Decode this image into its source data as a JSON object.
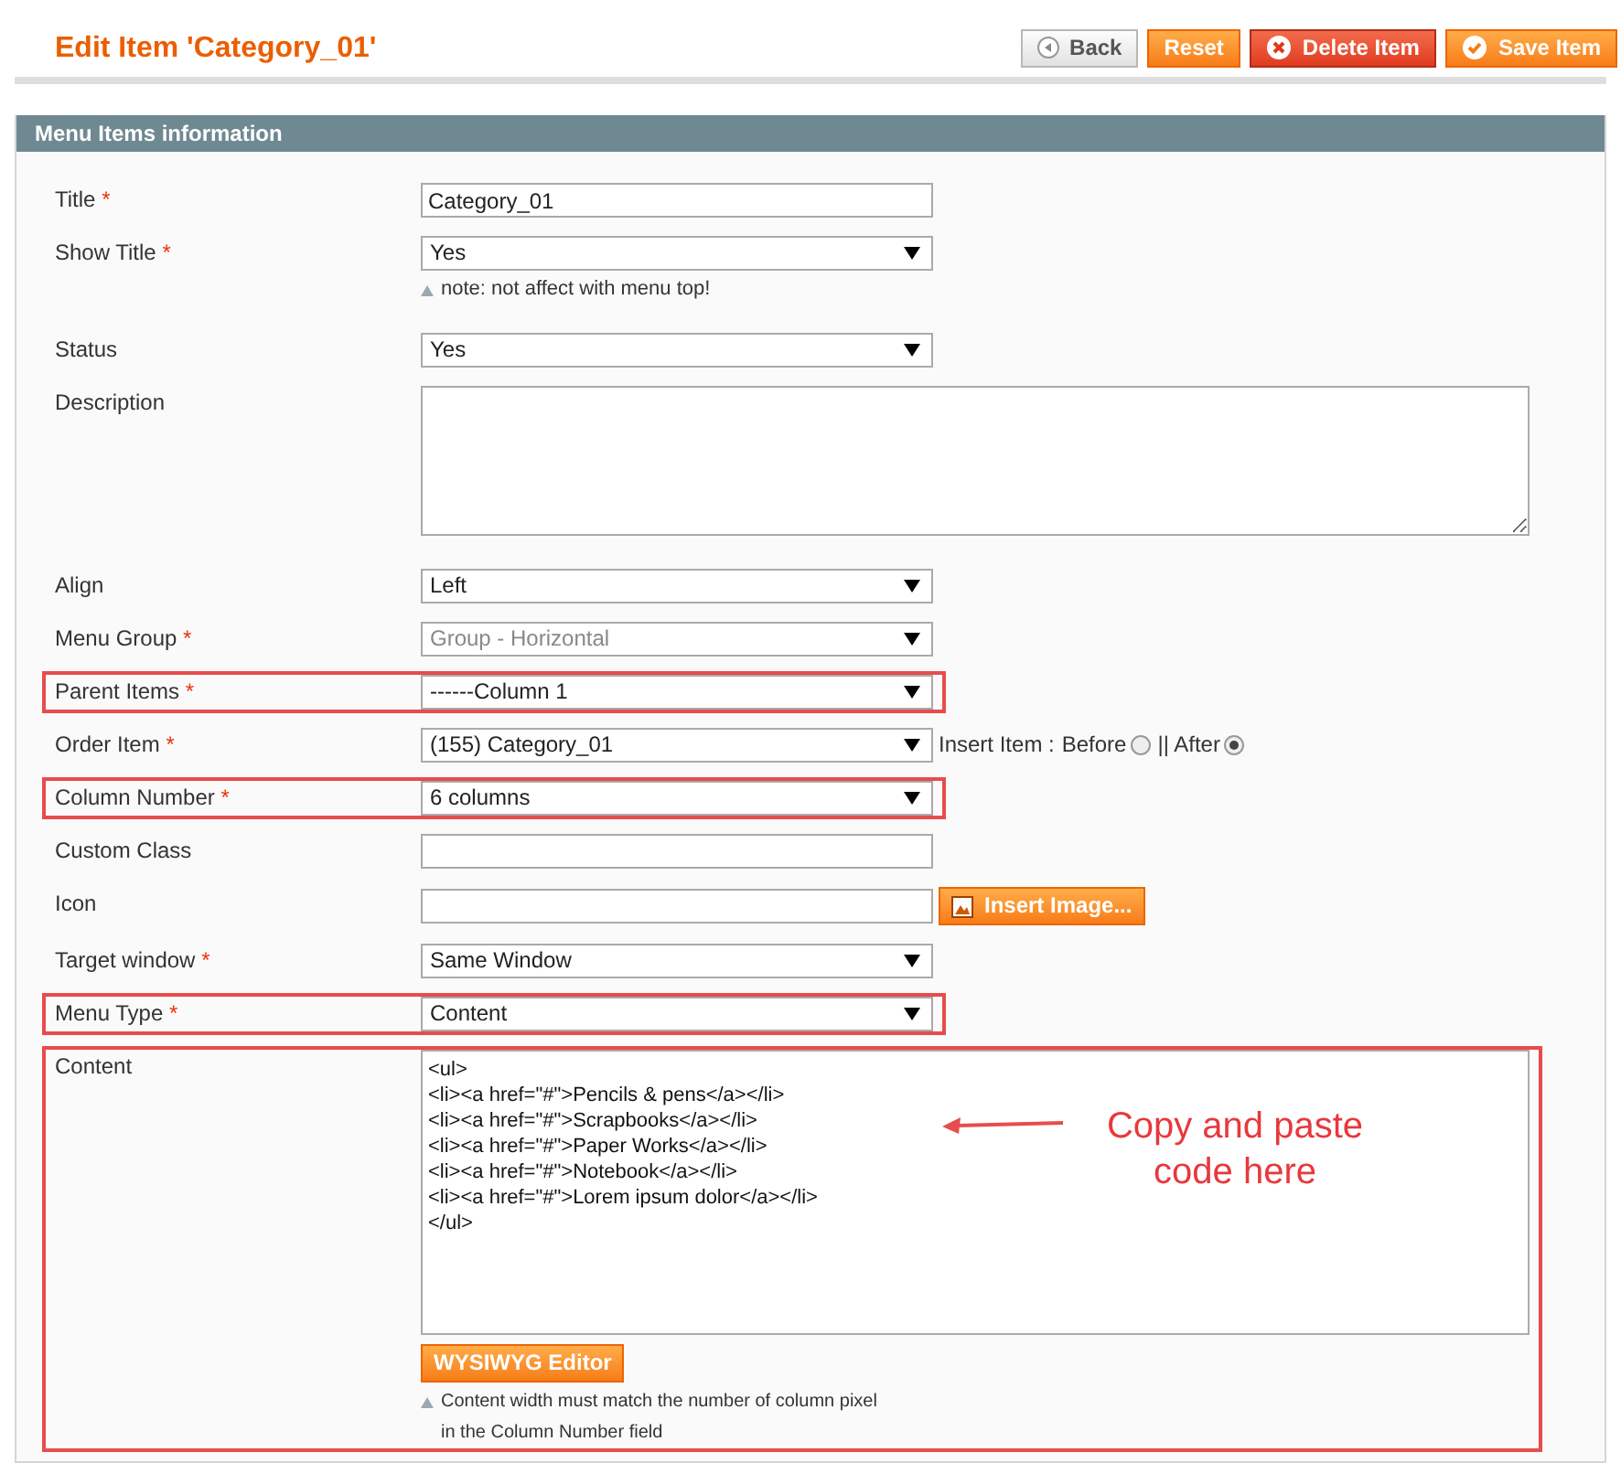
{
  "page_title": "Edit Item 'Category_01'",
  "buttons": [
    {
      "label": "Back",
      "kind": "back"
    },
    {
      "label": "Reset",
      "kind": "reset"
    },
    {
      "label": "Delete Item",
      "kind": "delete"
    },
    {
      "label": "Save Item",
      "kind": "save"
    }
  ],
  "section_title": "Menu Items information",
  "required_mark": "*",
  "fields": [
    {
      "kind": "text",
      "label": "Title",
      "required": true,
      "value": "Category_01",
      "highlighted": false
    },
    {
      "kind": "select",
      "label": "Show Title",
      "required": true,
      "value": "Yes",
      "highlighted": false,
      "note": "note: not affect with menu top!"
    },
    {
      "kind": "select",
      "label": "Status",
      "required": false,
      "value": "Yes",
      "highlighted": false
    },
    {
      "kind": "textarea",
      "label": "Description",
      "required": false,
      "highlighted": false
    },
    {
      "kind": "select",
      "label": "Align",
      "required": false,
      "value": "Left",
      "highlighted": false
    },
    {
      "kind": "select",
      "label": "Menu Group",
      "required": true,
      "value": "Group - Horizontal",
      "highlighted": false,
      "disabled": true
    },
    {
      "kind": "select",
      "label": "Parent Items",
      "required": true,
      "value": "------Column 1",
      "highlighted": true
    },
    {
      "kind": "select",
      "label": "Order Item",
      "required": true,
      "value": "(155) Category_01",
      "highlighted": false,
      "insert": {
        "label": "Insert Item :",
        "options": [
          {
            "label": "Before",
            "selected": false
          },
          {
            "label": "|| After",
            "selected": true
          }
        ]
      }
    },
    {
      "kind": "select",
      "label": "Column Number",
      "required": true,
      "value": "6 columns",
      "highlighted": true
    },
    {
      "kind": "text",
      "label": "Custom Class",
      "required": false,
      "highlighted": false
    },
    {
      "kind": "text",
      "label": "Icon",
      "required": false,
      "highlighted": false,
      "button": "Insert Image..."
    },
    {
      "kind": "select",
      "label": "Target window",
      "required": true,
      "value": "Same Window",
      "highlighted": false
    },
    {
      "kind": "select",
      "label": "Menu Type",
      "required": true,
      "value": "Content",
      "highlighted": true
    },
    {
      "kind": "content",
      "label": "Content",
      "required": false,
      "highlighted": true,
      "lines": [
        "<ul>",
        "<li><a href=\"#\">Pencils & pens</a></li>",
        "<li><a href=\"#\">Scrapbooks</a></li>",
        "<li><a href=\"#\">Paper Works</a></li>",
        "<li><a href=\"#\">Notebook</a></li>",
        "<li><a href=\"#\">Lorem ipsum dolor</a></li>",
        "</ul>"
      ],
      "button": "WYSIWYG Editor",
      "notes": [
        "Content width must match the number of column pixel",
        "in the Column Number field"
      ],
      "annotation": "Copy and paste code here"
    }
  ]
}
